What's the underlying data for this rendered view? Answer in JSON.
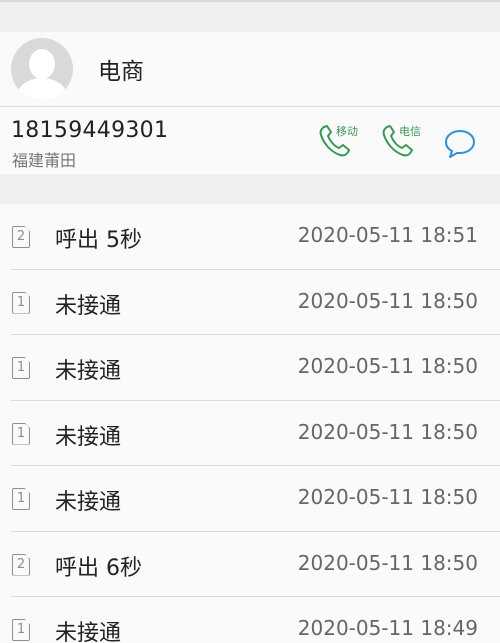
{
  "contact": {
    "name": "电商",
    "phone": "18159449301",
    "location": "福建莆田",
    "actions": {
      "mobile_label": "移动",
      "telecom_label": "电信"
    },
    "accent_color": "#3a9a55",
    "message_color": "#2f8fd8"
  },
  "call_log": [
    {
      "sim": "2",
      "status": "呼出 5秒",
      "time": "2020-05-11 18:51"
    },
    {
      "sim": "1",
      "status": "未接通",
      "time": "2020-05-11 18:50"
    },
    {
      "sim": "1",
      "status": "未接通",
      "time": "2020-05-11 18:50"
    },
    {
      "sim": "1",
      "status": "未接通",
      "time": "2020-05-11 18:50"
    },
    {
      "sim": "1",
      "status": "未接通",
      "time": "2020-05-11 18:50"
    },
    {
      "sim": "2",
      "status": "呼出 6秒",
      "time": "2020-05-11 18:50"
    },
    {
      "sim": "1",
      "status": "未接通",
      "time": "2020-05-11 18:49"
    }
  ]
}
